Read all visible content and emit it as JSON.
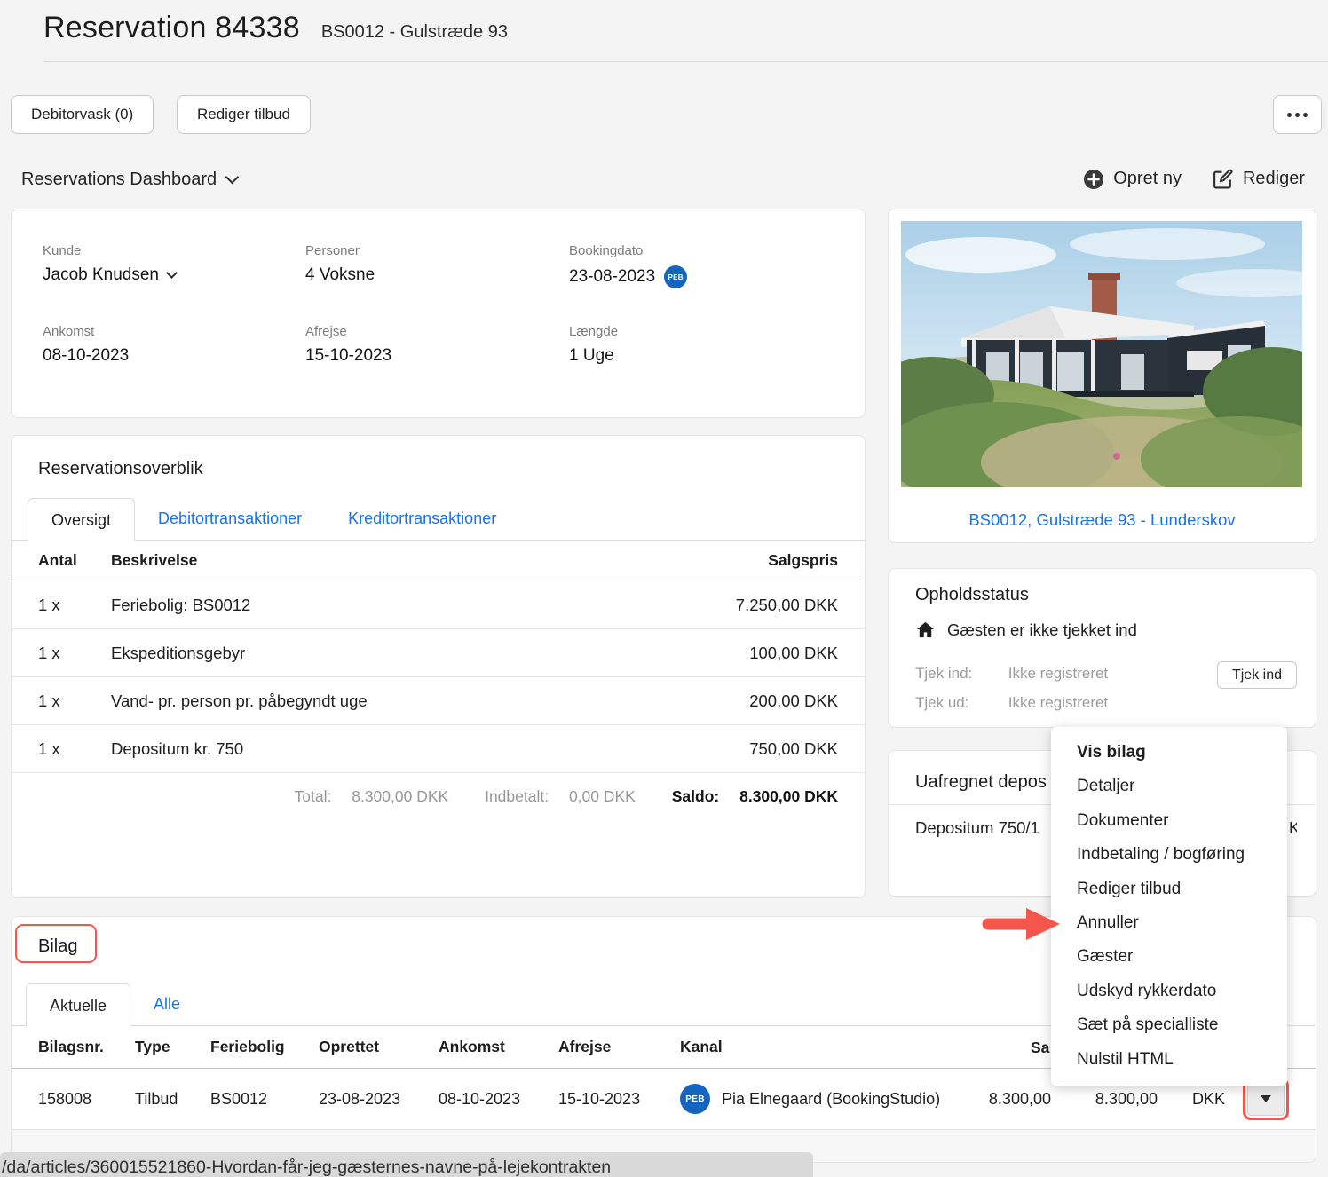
{
  "page": {
    "title": "Reservation 84338",
    "subtitle": "BS0012 - Gulstræde 93"
  },
  "toolbar": {
    "debitorvask_label": "Debitorvask (0)",
    "rediger_tilbud_label": "Rediger tilbud"
  },
  "dashboard_bar": {
    "selector_label": "Reservations Dashboard",
    "opret_ny_label": "Opret ny",
    "rediger_label": "Rediger"
  },
  "booking_info": {
    "fields": [
      {
        "label": "Kunde",
        "value": "Jacob Knudsen"
      },
      {
        "label": "Personer",
        "value": "4 Voksne"
      },
      {
        "label": "Bookingdato",
        "value": "23-08-2023",
        "badge": "PEB"
      },
      {
        "label": "Ankomst",
        "value": "08-10-2023"
      },
      {
        "label": "Afrejse",
        "value": "15-10-2023"
      },
      {
        "label": "Længde",
        "value": "1 Uge"
      }
    ]
  },
  "property": {
    "caption": "BS0012, Gulstræde 93 - Lunderskov"
  },
  "overview": {
    "title": "Reservationsoverblik",
    "tabs": [
      {
        "label": "Oversigt",
        "active": true
      },
      {
        "label": "Debitortransaktioner",
        "active": false
      },
      {
        "label": "Kreditortransaktioner",
        "active": false
      }
    ],
    "table": {
      "headers": [
        "Antal",
        "Beskrivelse",
        "Salgspris"
      ],
      "rows": [
        {
          "qty": "1 x",
          "desc": "Feriebolig: BS0012",
          "price": "7.250,00 DKK"
        },
        {
          "qty": "1 x",
          "desc": "Ekspeditionsgebyr",
          "price": "100,00 DKK"
        },
        {
          "qty": "1 x",
          "desc": "Vand- pr. person pr. påbegyndt uge",
          "price": "200,00 DKK"
        },
        {
          "qty": "1 x",
          "desc": "Depositum kr. 750",
          "price": "750,00 DKK"
        }
      ]
    },
    "totals": {
      "total_label": "Total:",
      "total_value": "8.300,00 DKK",
      "indbetalt_label": "Indbetalt:",
      "indbetalt_value": "0,00 DKK",
      "saldo_label": "Saldo:",
      "saldo_value": "8.300,00 DKK"
    }
  },
  "stay_status": {
    "title": "Opholdsstatus",
    "status_text": "Gæsten er ikke tjekket ind",
    "rows": [
      {
        "label": "Tjek ind:",
        "value": "Ikke registreret"
      },
      {
        "label": "Tjek ud:",
        "value": "Ikke registreret"
      }
    ],
    "button_label": "Tjek ind"
  },
  "deposit_panel": {
    "title_visible": "Uafregnet depos",
    "row_visible": "Depositum 750/1",
    "right_fragment": "K"
  },
  "context_menu": {
    "items": [
      "Vis bilag",
      "Detaljer",
      "Dokumenter",
      "Indbetaling / bogføring",
      "Rediger tilbud",
      "Annuller",
      "Gæster",
      "Udskyd rykkerdato",
      "Sæt på specialliste",
      "Nulstil HTML"
    ]
  },
  "bilag": {
    "title": "Bilag",
    "tabs": [
      {
        "label": "Aktuelle",
        "active": true
      },
      {
        "label": "Alle",
        "active": false
      }
    ],
    "headers": [
      "Bilagsnr.",
      "Type",
      "Feriebolig",
      "Oprettet",
      "Ankomst",
      "Afrejse",
      "Kanal",
      "Sa"
    ],
    "row": {
      "bilagsnr": "158008",
      "type": "Tilbud",
      "feriebolig": "BS0012",
      "oprettet": "23-08-2023",
      "ankomst": "08-10-2023",
      "afrejse": "15-10-2023",
      "kanal_badge": "PEB",
      "kanal": "Pia Elnegaard (BookingStudio)",
      "amount1": "8.300,00",
      "amount2": "8.300,00",
      "currency": "DKK"
    }
  },
  "status_tooltip": {
    "text": "/da/articles/360015521860-Hvordan-får-jeg-gæsternes-navne-på-lejekontrakten"
  },
  "colors": {
    "accent_blue": "#1a73e8",
    "badge_blue": "#1565c0",
    "accent_red": "#f4564b"
  }
}
